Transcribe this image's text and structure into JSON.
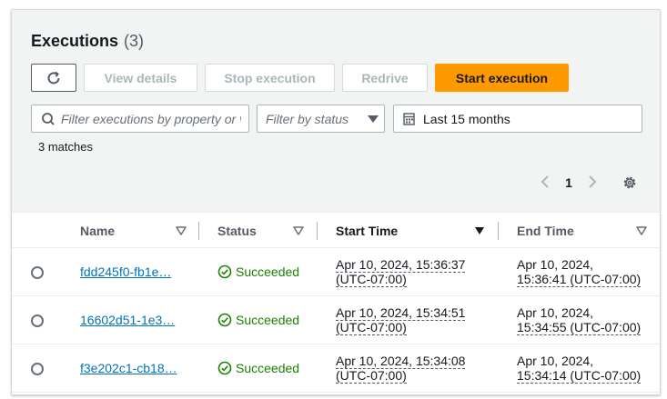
{
  "header": {
    "title": "Executions",
    "count": "(3)"
  },
  "toolbar": {
    "view_details": "View details",
    "stop_execution": "Stop execution",
    "redrive": "Redrive",
    "start_execution": "Start execution"
  },
  "filters": {
    "search_placeholder": "Filter executions by property or v",
    "status_placeholder": "Filter by status",
    "date_range": "Last 15 months"
  },
  "matches": "3 matches",
  "pagination": {
    "current_page": "1"
  },
  "table": {
    "columns": {
      "name": "Name",
      "status": "Status",
      "start_time": "Start Time",
      "end_time": "End Time"
    },
    "rows": [
      {
        "name": "fdd245f0-fb1e…",
        "status": "Succeeded",
        "start_line1": "Apr 10, 2024, 15:36:37",
        "start_line2": "(UTC-07:00)",
        "end_line1": "Apr 10, 2024,",
        "end_line2": "15:36:41 (UTC-07:00)"
      },
      {
        "name": "16602d51-1e3…",
        "status": "Succeeded",
        "start_line1": "Apr 10, 2024, 15:34:51",
        "start_line2": "(UTC-07:00)",
        "end_line1": "Apr 10, 2024,",
        "end_line2": "15:34:55 (UTC-07:00)"
      },
      {
        "name": "f3e202c1-cb18…",
        "status": "Succeeded",
        "start_line1": "Apr 10, 2024, 15:34:08",
        "start_line2": "(UTC-07:00)",
        "end_line1": "Apr 10, 2024,",
        "end_line2": "15:34:14 (UTC-07:00)"
      }
    ]
  },
  "colors": {
    "accent": "#ff9900",
    "link": "#0073bb",
    "success": "#1d8102"
  },
  "icons": {
    "refresh": "refresh-icon",
    "search": "search-icon",
    "calendar": "calendar-icon",
    "caret": "caret-down-icon",
    "settings": "gear-icon",
    "success": "check-circle-icon"
  }
}
